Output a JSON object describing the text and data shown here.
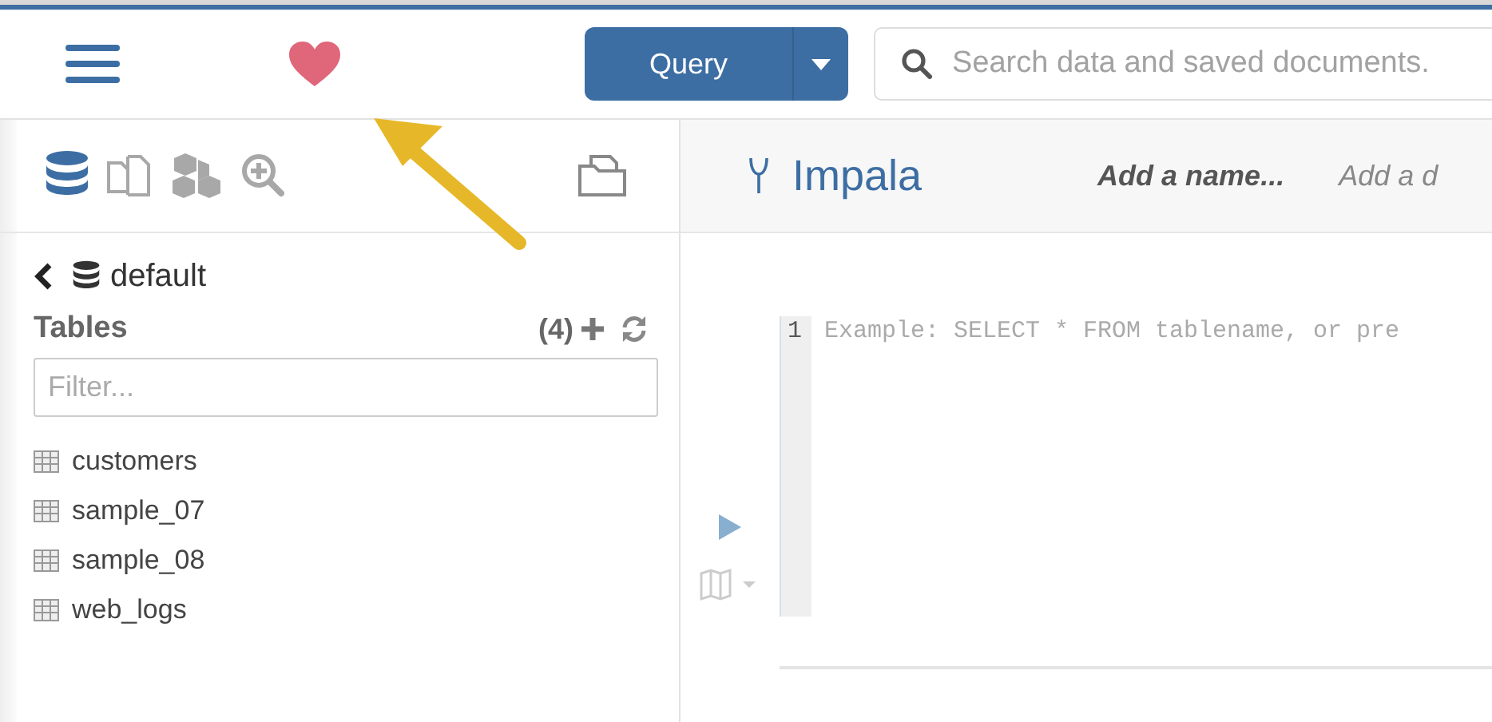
{
  "header": {
    "query_button": {
      "label": "Query"
    },
    "search": {
      "placeholder": "Search data and saved documents."
    }
  },
  "sidebar": {
    "panel_tabs": [
      {
        "kind": "database",
        "selected": true
      },
      {
        "kind": "documents",
        "selected": false
      },
      {
        "kind": "cubes",
        "selected": false
      },
      {
        "kind": "zoom",
        "selected": false
      }
    ],
    "breadcrumb": "default",
    "section": "Tables",
    "count": "(4)",
    "filter": {
      "placeholder": "Filter..."
    },
    "tables": [
      {
        "name": "customers"
      },
      {
        "name": "sample_07"
      },
      {
        "name": "sample_08"
      },
      {
        "name": "web_logs"
      }
    ]
  },
  "editor": {
    "title": "Impala",
    "name_placeholder": "Add a name...",
    "description_placeholder": "Add a d",
    "line_numbers": [
      "1"
    ],
    "placeholder": "Example: SELECT * FROM tablename, or pre"
  }
}
